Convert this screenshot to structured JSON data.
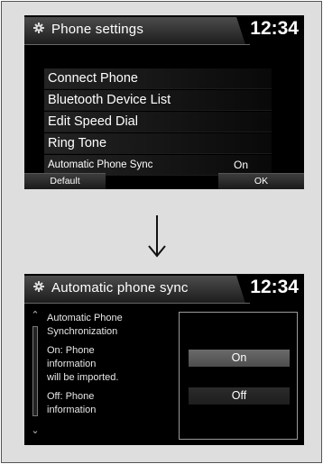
{
  "screen1": {
    "title": "Phone settings",
    "time": "12:34",
    "menu": [
      {
        "label": "Connect Phone"
      },
      {
        "label": "Bluetooth Device List"
      },
      {
        "label": "Edit Speed Dial"
      },
      {
        "label": "Ring Tone"
      },
      {
        "label": "Automatic Phone Sync",
        "value": "On"
      }
    ],
    "softkeys": {
      "left": "Default",
      "right": "OK"
    }
  },
  "arrow_icon": "down-arrow",
  "screen2": {
    "title": "Automatic phone sync",
    "time": "12:34",
    "description": {
      "heading_line1": "Automatic Phone",
      "heading_line2": "Synchronization",
      "on_line1": "On: Phone",
      "on_line2": "information",
      "on_line3": "will be imported.",
      "off_line1": "Off: Phone",
      "off_line2": "information"
    },
    "options": {
      "on": "On",
      "off": "Off"
    }
  },
  "colors": {
    "screen_bg": "#000000",
    "frame_bg": "#dedede",
    "highlight": "#5c5c5c"
  }
}
